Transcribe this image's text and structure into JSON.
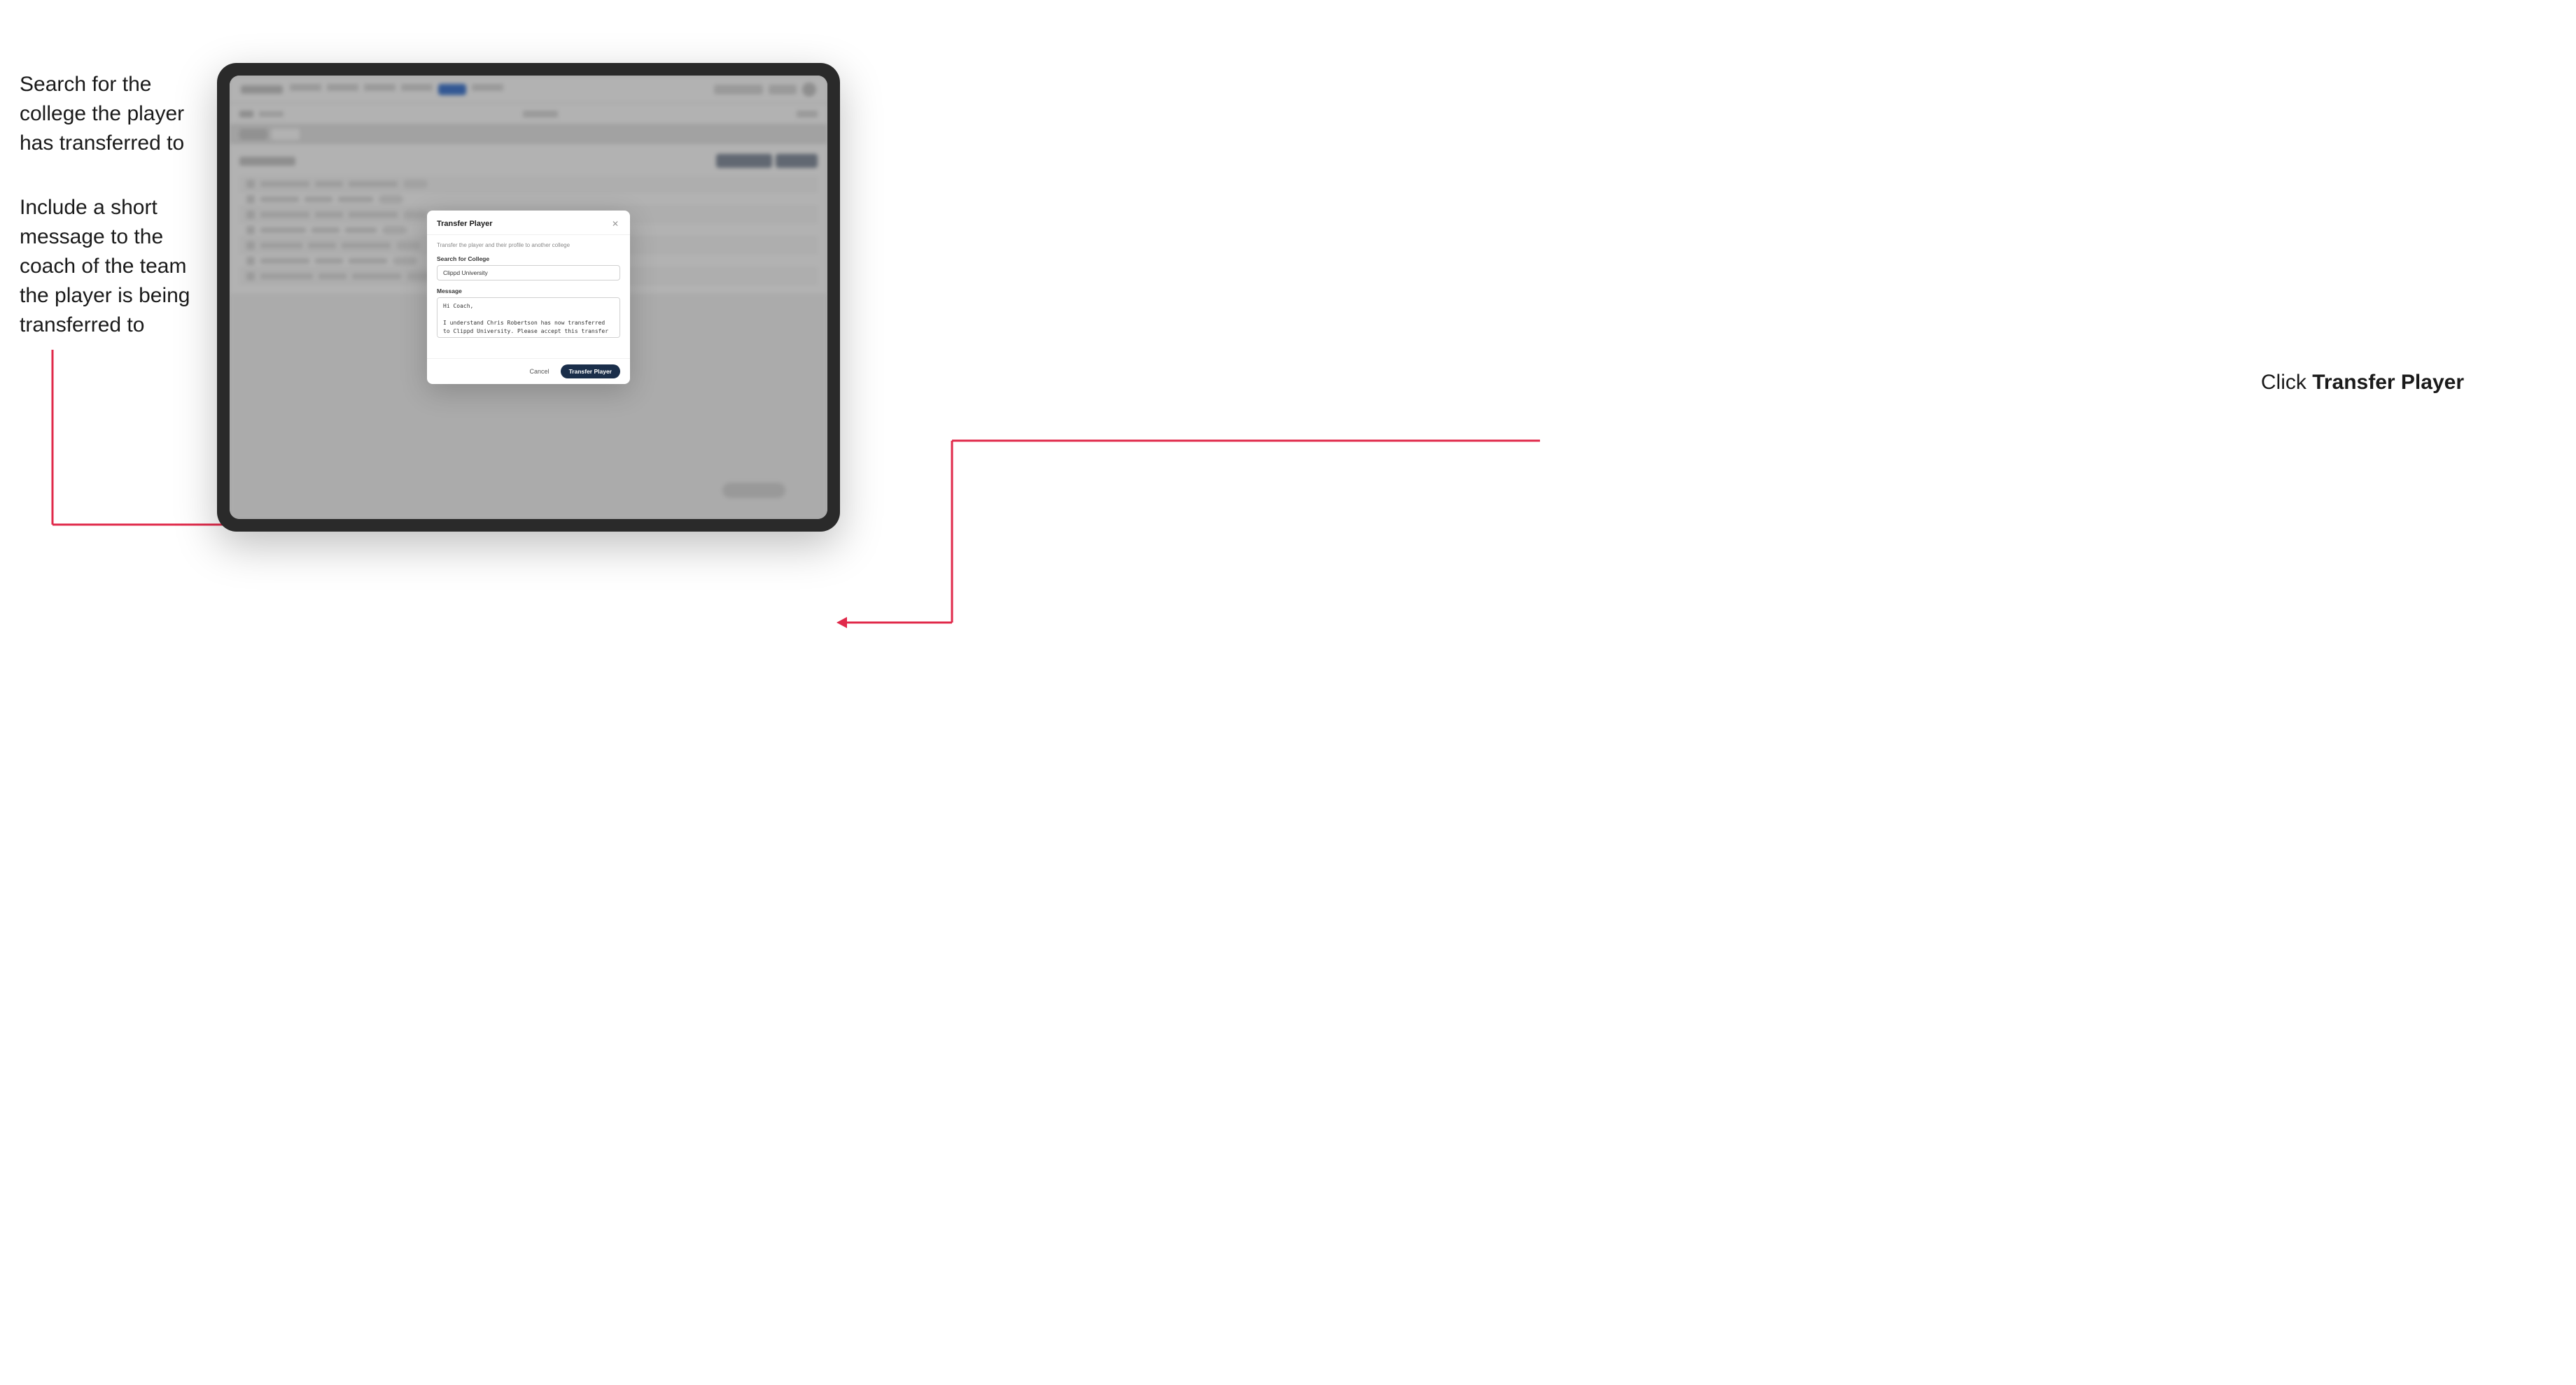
{
  "annotations": {
    "left_top": "Search for the college the player has transferred to",
    "left_bottom": "Include a short message to the coach of the team the player is being transferred to",
    "right": "Click ",
    "right_bold": "Transfer Player"
  },
  "modal": {
    "title": "Transfer Player",
    "description": "Transfer the player and their profile to another college",
    "search_label": "Search for College",
    "search_value": "Clippd University",
    "message_label": "Message",
    "message_value": "Hi Coach,\n\nI understand Chris Robertson has now transferred to Clippd University. Please accept this transfer request when you can.",
    "cancel_button": "Cancel",
    "transfer_button": "Transfer Player"
  }
}
